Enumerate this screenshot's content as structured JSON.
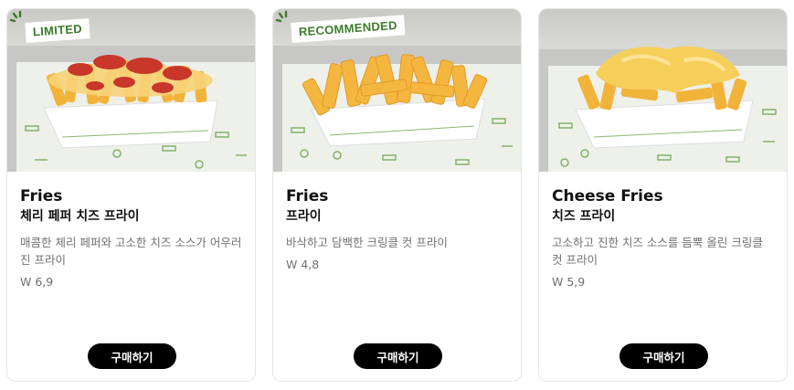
{
  "products": [
    {
      "badge": "LIMITED",
      "title": "Fries",
      "subtitle": "체리 페퍼 치즈 프라이",
      "description": "매콤한 체리 페퍼와 고소한 치즈 소스가 어우러진 프라이",
      "price": "W 6,9",
      "buy_label": "구매하기",
      "image": "cherry-pepper-cheese-fries-photo"
    },
    {
      "badge": "RECOMMENDED",
      "title": "Fries",
      "subtitle": "프라이",
      "description": "바삭하고 담백한 크링클 컷 프라이",
      "price": "W 4,8",
      "buy_label": "구매하기",
      "image": "crinkle-cut-fries-photo"
    },
    {
      "badge": "",
      "title": "Cheese Fries",
      "subtitle": "치즈 프라이",
      "description": "고소하고 진한 치즈 소스를 듬뿍 올린 크링클 컷 프라이",
      "price": "W 5,9",
      "buy_label": "구매하기",
      "image": "cheese-fries-photo"
    }
  ],
  "colors": {
    "badge_text": "#3d7a2b",
    "button_bg": "#000000",
    "button_text": "#ffffff",
    "muted_text": "#707070"
  }
}
